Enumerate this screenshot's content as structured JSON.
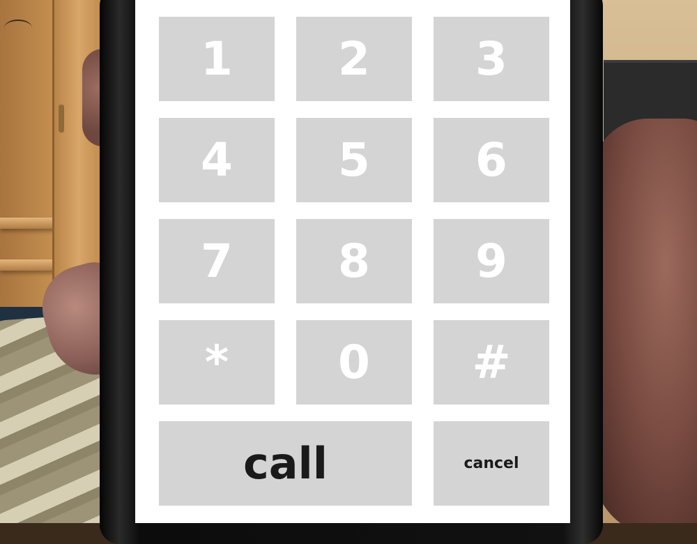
{
  "keypad": {
    "keys": [
      {
        "label": "1"
      },
      {
        "label": "2"
      },
      {
        "label": "3"
      },
      {
        "label": "4"
      },
      {
        "label": "5"
      },
      {
        "label": "6"
      },
      {
        "label": "7"
      },
      {
        "label": "8"
      },
      {
        "label": "9"
      },
      {
        "label": "*"
      },
      {
        "label": "0"
      },
      {
        "label": "#"
      }
    ],
    "call_label": "call",
    "cancel_label": "cancel"
  },
  "colors": {
    "key_background": "#d4d4d4",
    "screen_background": "#ffffff",
    "digit_text": "#ffffff",
    "action_text": "#1a1a1a"
  }
}
